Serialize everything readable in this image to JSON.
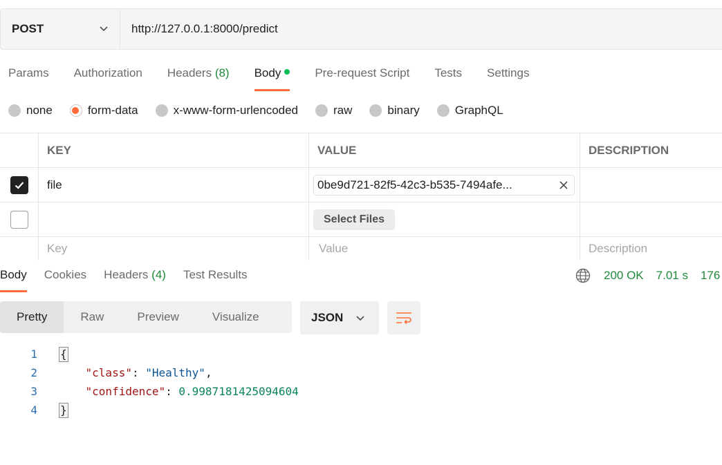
{
  "request": {
    "method": "POST",
    "url": "http://127.0.0.1:8000/predict"
  },
  "request_tabs": [
    {
      "label": "Params",
      "count": ""
    },
    {
      "label": "Authorization",
      "count": ""
    },
    {
      "label": "Headers",
      "count": "(8)"
    },
    {
      "label": "Body",
      "count": ""
    },
    {
      "label": "Pre-request Script",
      "count": ""
    },
    {
      "label": "Tests",
      "count": ""
    },
    {
      "label": "Settings",
      "count": ""
    }
  ],
  "body_types": [
    "none",
    "form-data",
    "x-www-form-urlencoded",
    "raw",
    "binary",
    "GraphQL"
  ],
  "selected_body_type": "form-data",
  "form_table": {
    "headers": {
      "key": "KEY",
      "value": "VALUE",
      "description": "DESCRIPTION"
    },
    "rows": [
      {
        "checked": true,
        "key": "file",
        "value": "0be9d721-82f5-42c3-b535-7494afe...",
        "description": ""
      },
      {
        "checked": false,
        "key": "",
        "value_button": "Select Files",
        "description": ""
      }
    ],
    "placeholders": {
      "key": "Key",
      "value": "Value",
      "description": "Description"
    }
  },
  "response_tabs": [
    {
      "label": "Body",
      "count": ""
    },
    {
      "label": "Cookies",
      "count": ""
    },
    {
      "label": "Headers",
      "count": "(4)"
    },
    {
      "label": "Test Results",
      "count": ""
    }
  ],
  "response_status": {
    "status": "200 OK",
    "time": "7.01 s",
    "size": "176"
  },
  "view_modes": [
    "Pretty",
    "Raw",
    "Preview",
    "Visualize"
  ],
  "format": "JSON",
  "code_lines": [
    {
      "n": "1"
    },
    {
      "n": "2",
      "key": "\"class\"",
      "value": "\"Healthy\""
    },
    {
      "n": "3",
      "key": "\"confidence\"",
      "value": "0.9987181425094604"
    },
    {
      "n": "4"
    }
  ],
  "colors": {
    "accent": "#ff6c37",
    "status_green": "#1f8a3b",
    "body_dot": "#0cbb52"
  }
}
